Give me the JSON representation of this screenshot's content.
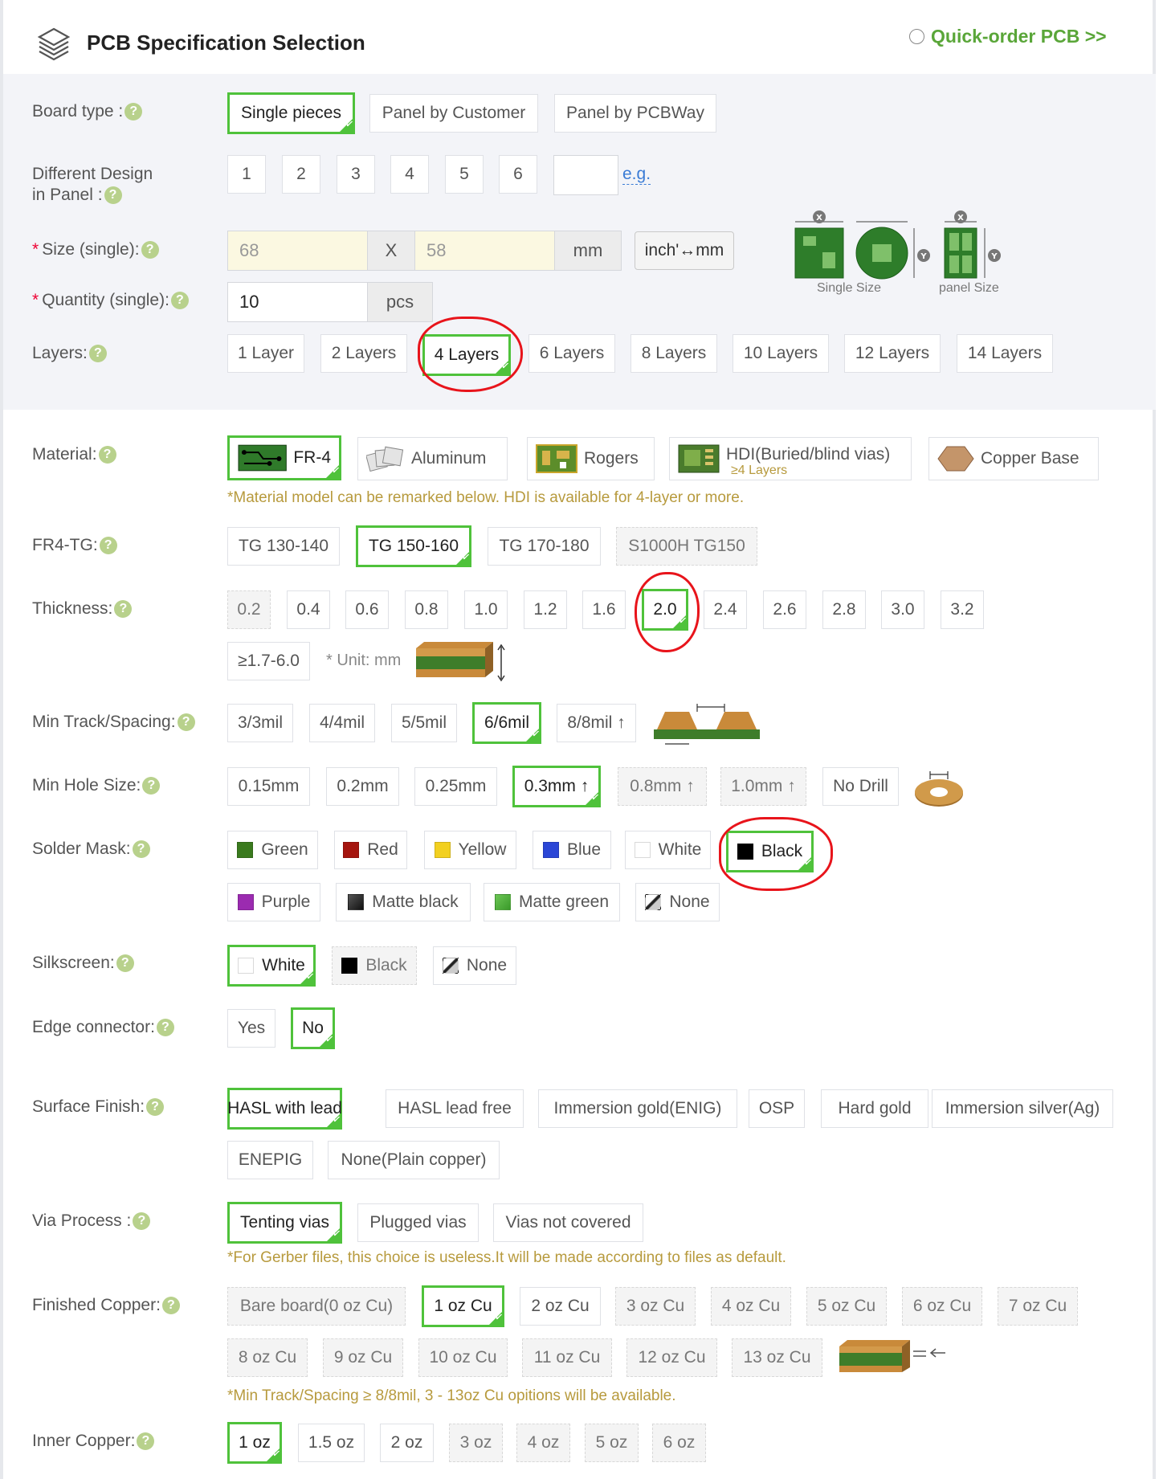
{
  "header": {
    "title": "PCB Specification Selection",
    "quick_order": "Quick-order PCB >>"
  },
  "board_type": {
    "label": "Board type :",
    "options": [
      "Single pieces",
      "Panel by Customer",
      "Panel by PCBWay"
    ],
    "selected": "Single pieces"
  },
  "design_panel": {
    "label_line1": "Different Design",
    "label_line2": "in Panel :",
    "options": [
      "1",
      "2",
      "3",
      "4",
      "5",
      "6"
    ],
    "custom_value": "",
    "eg": "e.g."
  },
  "size": {
    "label": "Size (single):",
    "required": "*",
    "x_value": "68",
    "separator": "X",
    "y_value": "58",
    "unit": "mm",
    "convert_button": "inch'↔mm",
    "single_caption": "Single Size",
    "panel_caption": "panel Size"
  },
  "quantity": {
    "label": "Quantity (single):",
    "required": "*",
    "value": "10",
    "unit": "pcs"
  },
  "layers": {
    "label": "Layers:",
    "options": [
      "1 Layer",
      "2 Layers",
      "4 Layers",
      "6 Layers",
      "8 Layers",
      "10 Layers",
      "12 Layers",
      "14 Layers"
    ],
    "selected": "4 Layers"
  },
  "material": {
    "label": "Material:",
    "options": [
      "FR-4",
      "Aluminum",
      "Rogers",
      "HDI(Buried/blind vias)",
      "Copper Base"
    ],
    "hdi_sub": "≥4 Layers",
    "selected": "FR-4",
    "note": "*Material model can be remarked below. HDI is available for 4-layer or more."
  },
  "fr4_tg": {
    "label": "FR4-TG:",
    "options": [
      "TG 130-140",
      "TG 150-160",
      "TG 170-180",
      "S1000H TG150"
    ],
    "selected": "TG 150-160"
  },
  "thickness": {
    "label": "Thickness:",
    "options": [
      "0.2",
      "0.4",
      "0.6",
      "0.8",
      "1.0",
      "1.2",
      "1.6",
      "2.0",
      "2.4",
      "2.6",
      "2.8",
      "3.0",
      "3.2"
    ],
    "extra": "≥1.7-6.0",
    "unit_note": "* Unit: mm",
    "selected": "2.0"
  },
  "track": {
    "label": "Min Track/Spacing:",
    "options": [
      "3/3mil",
      "4/4mil",
      "5/5mil",
      "6/6mil",
      "8/8mil ↑"
    ],
    "selected": "6/6mil"
  },
  "hole": {
    "label": "Min Hole Size:",
    "options": [
      "0.15mm",
      "0.2mm",
      "0.25mm",
      "0.3mm ↑",
      "0.8mm ↑",
      "1.0mm ↑",
      "No Drill"
    ],
    "selected": "0.3mm ↑"
  },
  "solder_mask": {
    "label": "Solder Mask:",
    "options": [
      {
        "name": "Green",
        "color": "#3a7a1e"
      },
      {
        "name": "Red",
        "color": "#a5150f"
      },
      {
        "name": "Yellow",
        "color": "#f2d020"
      },
      {
        "name": "Blue",
        "color": "#2b46d6"
      },
      {
        "name": "White",
        "color": "#ffffff"
      },
      {
        "name": "Black",
        "color": "#000000"
      },
      {
        "name": "Purple",
        "color": "#9b2bb0"
      },
      {
        "name": "Matte black",
        "color": "#222222"
      },
      {
        "name": "Matte green",
        "color": "#4caf3a"
      },
      {
        "name": "None",
        "color": "none"
      }
    ],
    "selected": "Black"
  },
  "silkscreen": {
    "label": "Silkscreen:",
    "options": [
      "White",
      "Black",
      "None"
    ],
    "selected": "White"
  },
  "edge": {
    "label": "Edge connector:",
    "options": [
      "Yes",
      "No"
    ],
    "selected": "No"
  },
  "surface": {
    "label": "Surface Finish:",
    "options": [
      "HASL with lead",
      "HASL lead free",
      "Immersion gold(ENIG)",
      "OSP",
      "Hard gold",
      "Immersion silver(Ag)",
      "ENEPIG",
      "None(Plain copper)"
    ],
    "selected": "HASL with lead"
  },
  "via": {
    "label": "Via Process :",
    "options": [
      "Tenting vias",
      "Plugged vias",
      "Vias not covered"
    ],
    "selected": "Tenting vias",
    "note": "*For Gerber files, this choice is useless.It will be made according to files as default."
  },
  "copper": {
    "label": "Finished Copper:",
    "options": [
      "Bare board(0 oz Cu)",
      "1 oz Cu",
      "2 oz Cu",
      "3 oz Cu",
      "4 oz Cu",
      "5 oz Cu",
      "6 oz Cu",
      "7 oz Cu",
      "8 oz Cu",
      "9 oz Cu",
      "10 oz Cu",
      "11 oz Cu",
      "12 oz Cu",
      "13 oz Cu"
    ],
    "selected": "1 oz Cu",
    "note": "*Min Track/Spacing ≥ 8/8mil, 3 - 13oz Cu opitions will be available."
  },
  "inner": {
    "label": "Inner Copper:",
    "options": [
      "1 oz",
      "1.5 oz",
      "2 oz",
      "3 oz",
      "4 oz",
      "5 oz",
      "6 oz"
    ],
    "selected": "1 oz"
  }
}
